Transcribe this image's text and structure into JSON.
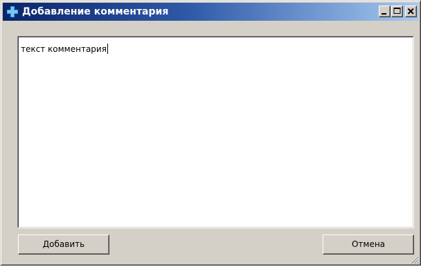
{
  "window": {
    "title": "Добавление комментария",
    "controls": {
      "minimize": "minimize-icon",
      "maximize": "maximize-icon",
      "close": "close-icon"
    },
    "title_icon": "plus-icon",
    "colors": {
      "titlebar_start": "#0a246a",
      "titlebar_end": "#a6caf0",
      "face": "#d4d0c8",
      "icon_plus": "#3aa0e8"
    }
  },
  "comment": {
    "value": "текст комментария"
  },
  "buttons": {
    "add_label": "Добавить",
    "cancel_label": "Отмена"
  }
}
